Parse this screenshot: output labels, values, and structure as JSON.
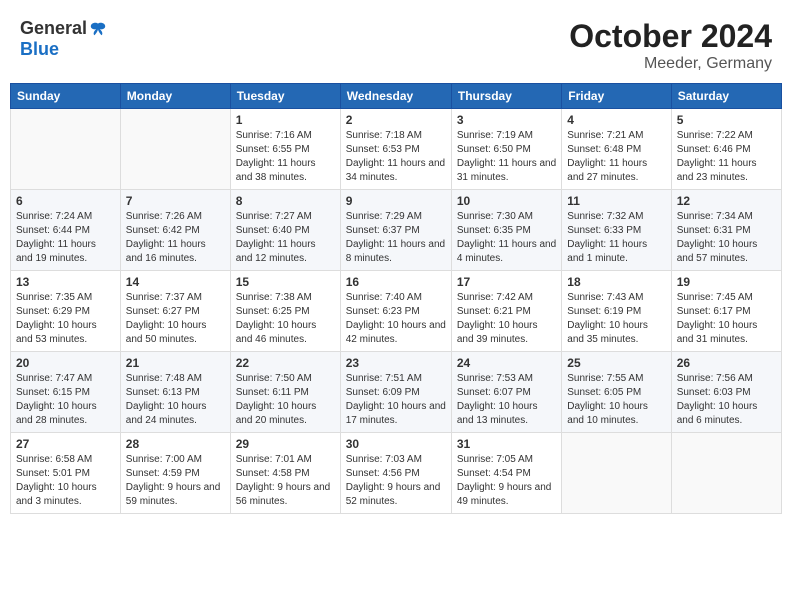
{
  "header": {
    "logo_general": "General",
    "logo_blue": "Blue",
    "month_title": "October 2024",
    "location": "Meeder, Germany"
  },
  "days_of_week": [
    "Sunday",
    "Monday",
    "Tuesday",
    "Wednesday",
    "Thursday",
    "Friday",
    "Saturday"
  ],
  "weeks": [
    [
      {
        "day": "",
        "sunrise": "",
        "sunset": "",
        "daylight": ""
      },
      {
        "day": "",
        "sunrise": "",
        "sunset": "",
        "daylight": ""
      },
      {
        "day": "1",
        "sunrise": "Sunrise: 7:16 AM",
        "sunset": "Sunset: 6:55 PM",
        "daylight": "Daylight: 11 hours and 38 minutes."
      },
      {
        "day": "2",
        "sunrise": "Sunrise: 7:18 AM",
        "sunset": "Sunset: 6:53 PM",
        "daylight": "Daylight: 11 hours and 34 minutes."
      },
      {
        "day": "3",
        "sunrise": "Sunrise: 7:19 AM",
        "sunset": "Sunset: 6:50 PM",
        "daylight": "Daylight: 11 hours and 31 minutes."
      },
      {
        "day": "4",
        "sunrise": "Sunrise: 7:21 AM",
        "sunset": "Sunset: 6:48 PM",
        "daylight": "Daylight: 11 hours and 27 minutes."
      },
      {
        "day": "5",
        "sunrise": "Sunrise: 7:22 AM",
        "sunset": "Sunset: 6:46 PM",
        "daylight": "Daylight: 11 hours and 23 minutes."
      }
    ],
    [
      {
        "day": "6",
        "sunrise": "Sunrise: 7:24 AM",
        "sunset": "Sunset: 6:44 PM",
        "daylight": "Daylight: 11 hours and 19 minutes."
      },
      {
        "day": "7",
        "sunrise": "Sunrise: 7:26 AM",
        "sunset": "Sunset: 6:42 PM",
        "daylight": "Daylight: 11 hours and 16 minutes."
      },
      {
        "day": "8",
        "sunrise": "Sunrise: 7:27 AM",
        "sunset": "Sunset: 6:40 PM",
        "daylight": "Daylight: 11 hours and 12 minutes."
      },
      {
        "day": "9",
        "sunrise": "Sunrise: 7:29 AM",
        "sunset": "Sunset: 6:37 PM",
        "daylight": "Daylight: 11 hours and 8 minutes."
      },
      {
        "day": "10",
        "sunrise": "Sunrise: 7:30 AM",
        "sunset": "Sunset: 6:35 PM",
        "daylight": "Daylight: 11 hours and 4 minutes."
      },
      {
        "day": "11",
        "sunrise": "Sunrise: 7:32 AM",
        "sunset": "Sunset: 6:33 PM",
        "daylight": "Daylight: 11 hours and 1 minute."
      },
      {
        "day": "12",
        "sunrise": "Sunrise: 7:34 AM",
        "sunset": "Sunset: 6:31 PM",
        "daylight": "Daylight: 10 hours and 57 minutes."
      }
    ],
    [
      {
        "day": "13",
        "sunrise": "Sunrise: 7:35 AM",
        "sunset": "Sunset: 6:29 PM",
        "daylight": "Daylight: 10 hours and 53 minutes."
      },
      {
        "day": "14",
        "sunrise": "Sunrise: 7:37 AM",
        "sunset": "Sunset: 6:27 PM",
        "daylight": "Daylight: 10 hours and 50 minutes."
      },
      {
        "day": "15",
        "sunrise": "Sunrise: 7:38 AM",
        "sunset": "Sunset: 6:25 PM",
        "daylight": "Daylight: 10 hours and 46 minutes."
      },
      {
        "day": "16",
        "sunrise": "Sunrise: 7:40 AM",
        "sunset": "Sunset: 6:23 PM",
        "daylight": "Daylight: 10 hours and 42 minutes."
      },
      {
        "day": "17",
        "sunrise": "Sunrise: 7:42 AM",
        "sunset": "Sunset: 6:21 PM",
        "daylight": "Daylight: 10 hours and 39 minutes."
      },
      {
        "day": "18",
        "sunrise": "Sunrise: 7:43 AM",
        "sunset": "Sunset: 6:19 PM",
        "daylight": "Daylight: 10 hours and 35 minutes."
      },
      {
        "day": "19",
        "sunrise": "Sunrise: 7:45 AM",
        "sunset": "Sunset: 6:17 PM",
        "daylight": "Daylight: 10 hours and 31 minutes."
      }
    ],
    [
      {
        "day": "20",
        "sunrise": "Sunrise: 7:47 AM",
        "sunset": "Sunset: 6:15 PM",
        "daylight": "Daylight: 10 hours and 28 minutes."
      },
      {
        "day": "21",
        "sunrise": "Sunrise: 7:48 AM",
        "sunset": "Sunset: 6:13 PM",
        "daylight": "Daylight: 10 hours and 24 minutes."
      },
      {
        "day": "22",
        "sunrise": "Sunrise: 7:50 AM",
        "sunset": "Sunset: 6:11 PM",
        "daylight": "Daylight: 10 hours and 20 minutes."
      },
      {
        "day": "23",
        "sunrise": "Sunrise: 7:51 AM",
        "sunset": "Sunset: 6:09 PM",
        "daylight": "Daylight: 10 hours and 17 minutes."
      },
      {
        "day": "24",
        "sunrise": "Sunrise: 7:53 AM",
        "sunset": "Sunset: 6:07 PM",
        "daylight": "Daylight: 10 hours and 13 minutes."
      },
      {
        "day": "25",
        "sunrise": "Sunrise: 7:55 AM",
        "sunset": "Sunset: 6:05 PM",
        "daylight": "Daylight: 10 hours and 10 minutes."
      },
      {
        "day": "26",
        "sunrise": "Sunrise: 7:56 AM",
        "sunset": "Sunset: 6:03 PM",
        "daylight": "Daylight: 10 hours and 6 minutes."
      }
    ],
    [
      {
        "day": "27",
        "sunrise": "Sunrise: 6:58 AM",
        "sunset": "Sunset: 5:01 PM",
        "daylight": "Daylight: 10 hours and 3 minutes."
      },
      {
        "day": "28",
        "sunrise": "Sunrise: 7:00 AM",
        "sunset": "Sunset: 4:59 PM",
        "daylight": "Daylight: 9 hours and 59 minutes."
      },
      {
        "day": "29",
        "sunrise": "Sunrise: 7:01 AM",
        "sunset": "Sunset: 4:58 PM",
        "daylight": "Daylight: 9 hours and 56 minutes."
      },
      {
        "day": "30",
        "sunrise": "Sunrise: 7:03 AM",
        "sunset": "Sunset: 4:56 PM",
        "daylight": "Daylight: 9 hours and 52 minutes."
      },
      {
        "day": "31",
        "sunrise": "Sunrise: 7:05 AM",
        "sunset": "Sunset: 4:54 PM",
        "daylight": "Daylight: 9 hours and 49 minutes."
      },
      {
        "day": "",
        "sunrise": "",
        "sunset": "",
        "daylight": ""
      },
      {
        "day": "",
        "sunrise": "",
        "sunset": "",
        "daylight": ""
      }
    ]
  ]
}
